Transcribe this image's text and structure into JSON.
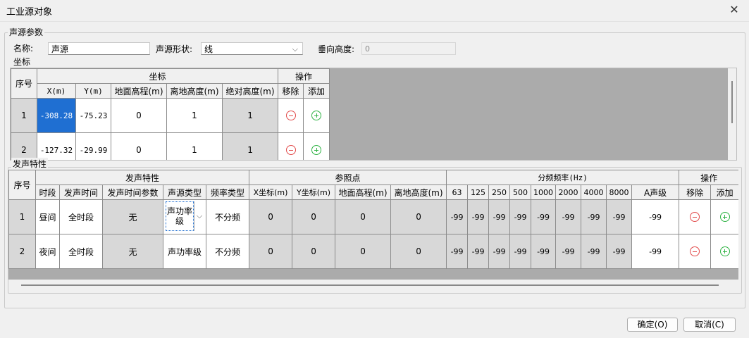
{
  "window": {
    "title": "工业源对象",
    "close_glyph": "✕"
  },
  "params": {
    "group_label": "声源参数",
    "name_label": "名称:",
    "name_value": "声源",
    "shape_label": "声源形状:",
    "shape_value": "线",
    "height_label": "垂向高度:",
    "height_value": "0"
  },
  "coords": {
    "group_label": "坐标",
    "h_index": "序号",
    "h_coord": "坐标",
    "h_ops": "操作",
    "cols": [
      "X(m)",
      "Y(m)",
      "地面高程(m)",
      "离地高度(m)",
      "绝对高度(m)"
    ],
    "op_cols": [
      "移除",
      "添加"
    ],
    "rows": [
      {
        "idx": "1",
        "x": "-308.28",
        "y": "-75.23",
        "ground": "0",
        "above": "1",
        "abs": "1"
      },
      {
        "idx": "2",
        "x": "-127.32",
        "y": "-29.99",
        "ground": "0",
        "above": "1",
        "abs": "1"
      }
    ]
  },
  "emission": {
    "group_label": "发声特性",
    "h_index": "序号",
    "h_char": "发声特性",
    "h_ref": "参照点",
    "h_freq": "分频频率(Hz)",
    "h_ops": "操作",
    "char_cols": [
      "时段",
      "发声时间",
      "发声时间参数",
      "声源类型",
      "频率类型"
    ],
    "ref_cols": [
      "X坐标(m)",
      "Y坐标(m)",
      "地面高程(m)",
      "离地高度(m)"
    ],
    "freq_cols": [
      "63",
      "125",
      "250",
      "500",
      "1000",
      "2000",
      "4000",
      "8000",
      "A声级"
    ],
    "op_cols": [
      "移除",
      "添加"
    ],
    "rows": [
      {
        "idx": "1",
        "period": "昼间",
        "time": "全时段",
        "param": "无",
        "stype": "声功率级",
        "ftype": "不分频",
        "rx": "0",
        "ry": "0",
        "rg": "0",
        "rh": "0",
        "f": [
          "-99",
          "-99",
          "-99",
          "-99",
          "-99",
          "-99",
          "-99",
          "-99"
        ],
        "a": "-99"
      },
      {
        "idx": "2",
        "period": "夜间",
        "time": "全时段",
        "param": "无",
        "stype": "声功率级",
        "ftype": "不分频",
        "rx": "0",
        "ry": "0",
        "rg": "0",
        "rh": "0",
        "f": [
          "-99",
          "-99",
          "-99",
          "-99",
          "-99",
          "-99",
          "-99",
          "-99"
        ],
        "a": "-99"
      }
    ]
  },
  "buttons": {
    "ok": "确定(O)",
    "cancel": "取消(C)"
  }
}
